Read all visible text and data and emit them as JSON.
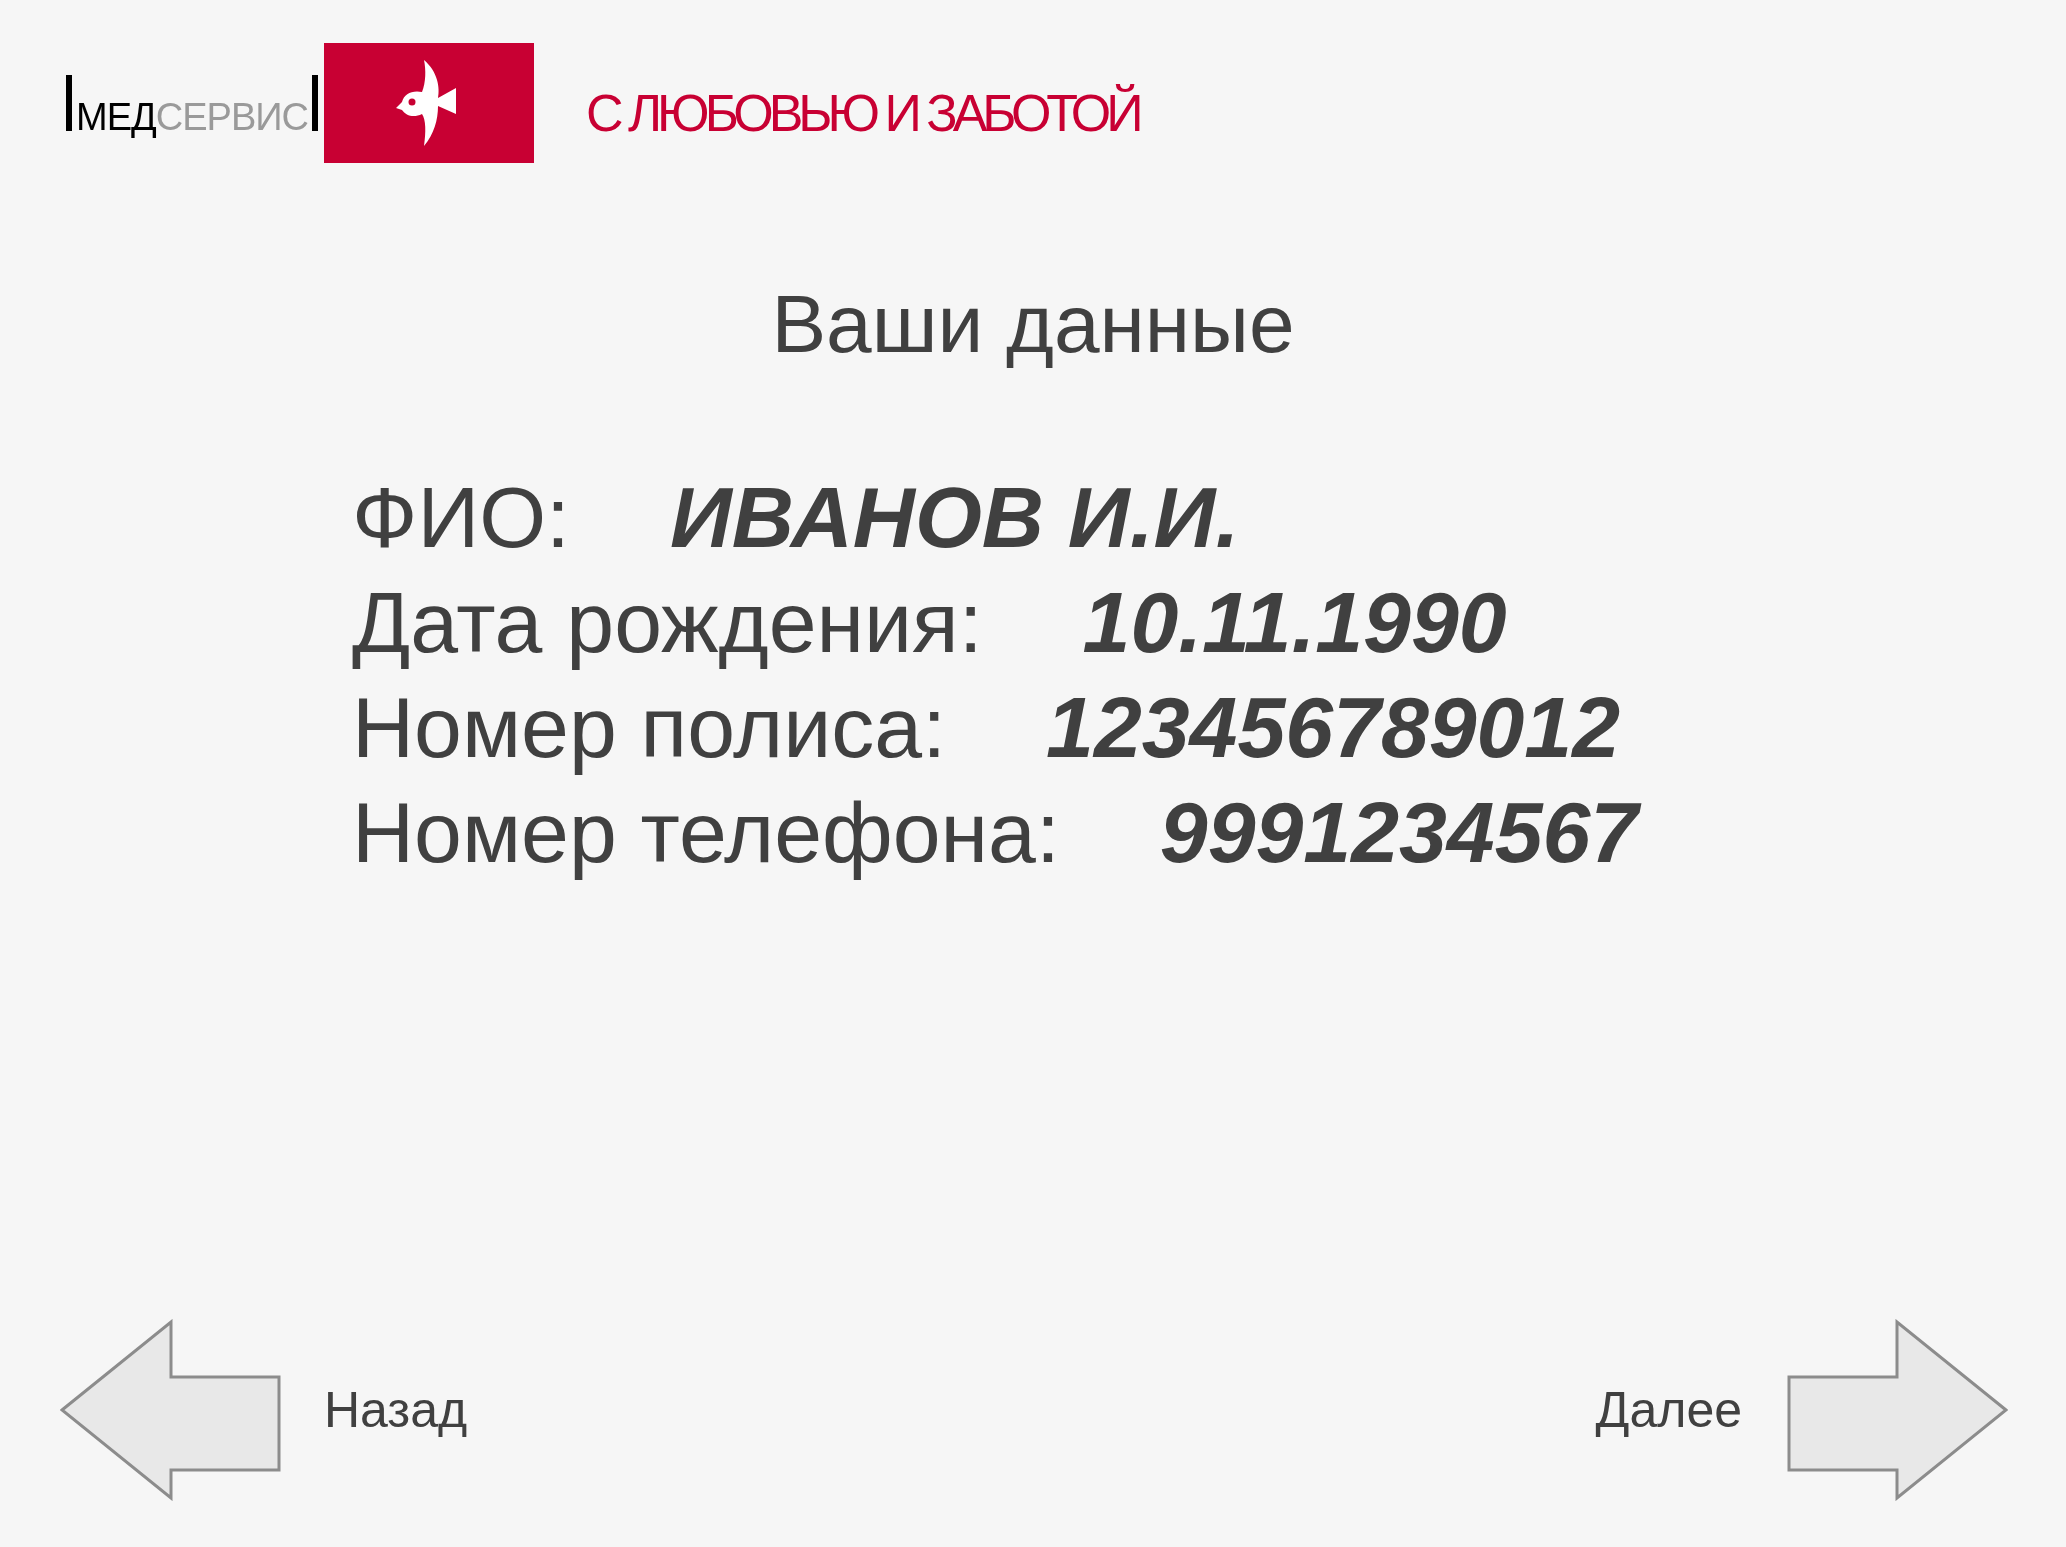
{
  "logo": {
    "brand_dark": "МЕД",
    "brand_light": "СЕРВИС"
  },
  "tagline": "С ЛЮБОВЬЮ И ЗАБОТОЙ",
  "title": "Ваши данные",
  "fields": [
    {
      "label": "ФИО:",
      "value": "ИВАНОВ И.И."
    },
    {
      "label": "Дата рождения:",
      "value": "10.11.1990"
    },
    {
      "label": "Номер полиса:",
      "value": "123456789012"
    },
    {
      "label": "Номер телефона:",
      "value": "9991234567"
    }
  ],
  "nav": {
    "back": "Назад",
    "next": "Далее"
  }
}
